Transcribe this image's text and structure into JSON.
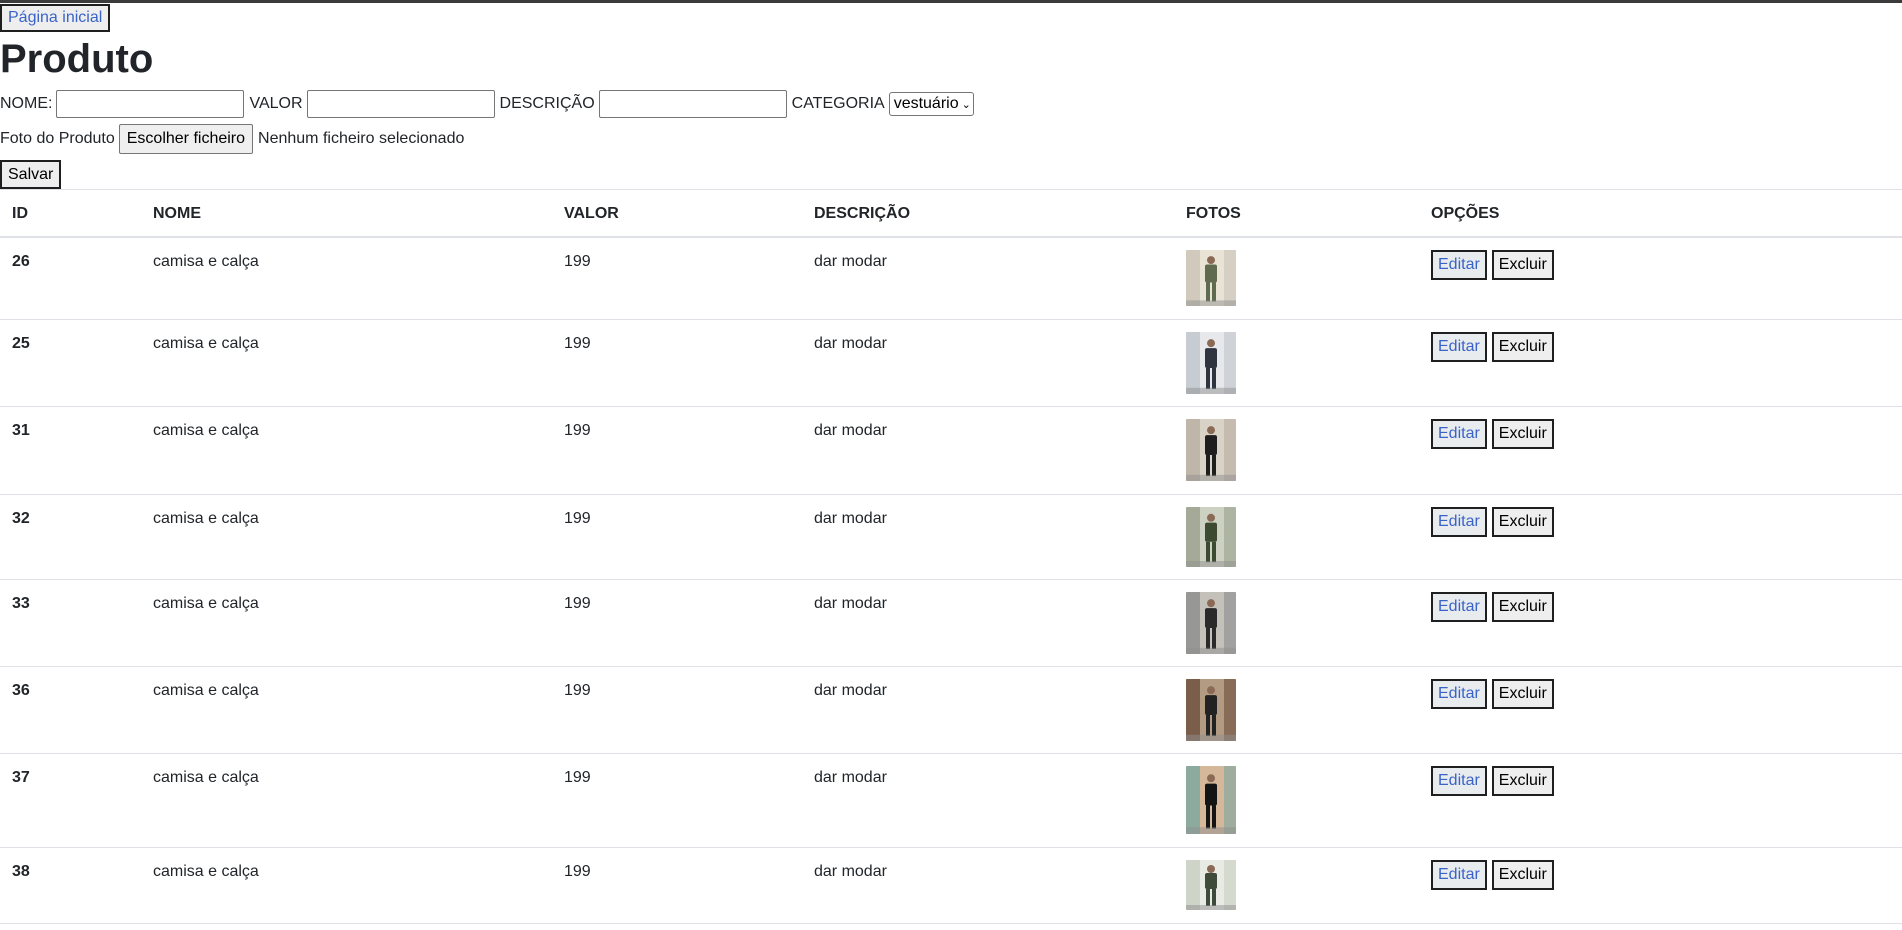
{
  "nav": {
    "home_label": "Página inicial"
  },
  "page": {
    "title": "Produto"
  },
  "form": {
    "nome_label": "NOME:",
    "nome_value": "",
    "valor_label": "VALOR",
    "valor_value": "",
    "descricao_label": "DESCRIÇÃO",
    "descricao_value": "",
    "categoria_label": "CATEGORIA",
    "categoria_selected": "vestuário",
    "foto_label": "Foto do Produto",
    "file_button_label": "Escolher ficheiro",
    "file_status": "Nenhum ficheiro selecionado",
    "save_label": "Salvar"
  },
  "table": {
    "headers": [
      "ID",
      "NOME",
      "VALOR",
      "DESCRIÇÃO",
      "FOTOS",
      "OPÇÕES"
    ],
    "edit_label": "Editar",
    "delete_label": "Excluir",
    "rows": [
      {
        "id": "26",
        "nome": "camisa e calça",
        "valor": "199",
        "descricao": "dar modar"
      },
      {
        "id": "25",
        "nome": "camisa e calça",
        "valor": "199",
        "descricao": "dar modar"
      },
      {
        "id": "31",
        "nome": "camisa e calça",
        "valor": "199",
        "descricao": "dar modar"
      },
      {
        "id": "32",
        "nome": "camisa e calça",
        "valor": "199",
        "descricao": "dar modar"
      },
      {
        "id": "33",
        "nome": "camisa e calça",
        "valor": "199",
        "descricao": "dar modar"
      },
      {
        "id": "36",
        "nome": "camisa e calça",
        "valor": "199",
        "descricao": "dar modar"
      },
      {
        "id": "37",
        "nome": "camisa e calça",
        "valor": "199",
        "descricao": "dar modar"
      },
      {
        "id": "38",
        "nome": "camisa e calça",
        "valor": "199",
        "descricao": "dar modar"
      }
    ]
  },
  "colors": {
    "link_blue": "#3a63c8",
    "border": "#dee2e6",
    "text": "#212529"
  }
}
